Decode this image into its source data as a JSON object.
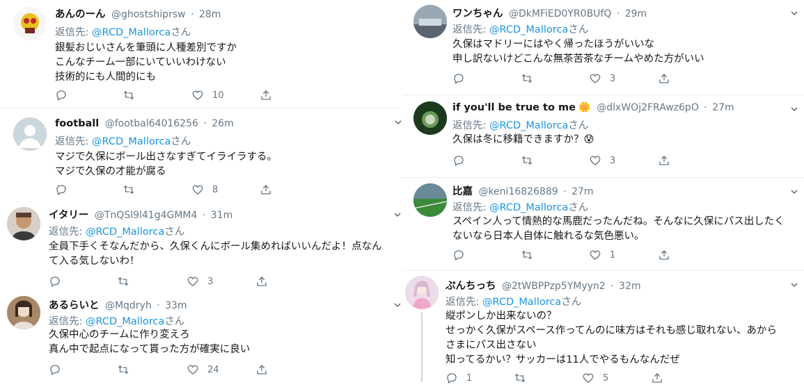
{
  "reply_prefix": "返信先: ",
  "reply_suffix": "さん",
  "icons": {
    "reply": "reply-icon",
    "retweet": "retweet-icon",
    "like": "heart-icon",
    "share": "share-icon",
    "more": "chevron-down-icon"
  },
  "colors": {
    "mention": "#1b95e0",
    "secondary": "#657786",
    "divider": "#e6ecf0"
  },
  "tweets": [
    {
      "name": "あんのーん",
      "handle": "@ghostshiprsw",
      "time": "28m",
      "reply_to": "@RCD_Mallorca",
      "lines": [
        "銀髪おじいさんを筆頭に人種差別ですか",
        "こんなチーム一部にいていいわけない",
        "技術的にも人間的にも"
      ],
      "replies": "",
      "retweets": "",
      "likes": "10"
    },
    {
      "name": "football",
      "handle": "@footbal64016256",
      "time": "26m",
      "reply_to": "@RCD_Mallorca",
      "lines": [
        "マジで久保にボール出さなすぎてイライラする。",
        "マジで久保の才能が腐る"
      ],
      "replies": "",
      "retweets": "",
      "likes": "8"
    },
    {
      "name": "イタリー",
      "handle": "@TnQSl9l41g4GMM4",
      "time": "31m",
      "reply_to": "@RCD_Mallorca",
      "lines": [
        "全員下手くそなんだから、久保くんにボール集めればいいんだよ！点なん",
        "て入る気しないわ！"
      ],
      "replies": "",
      "retweets": "",
      "likes": "3"
    },
    {
      "name": "あるらいと",
      "handle": "@Mqdryh",
      "time": "33m",
      "reply_to": "@RCD_Mallorca",
      "lines": [
        "久保中心のチームに作り変えろ",
        "真ん中で起点になって貰った方が確実に良い"
      ],
      "replies": "",
      "retweets": "",
      "likes": "24"
    },
    {
      "name": "ワンちゃん",
      "handle": "@DkMFiED0YR0BUfQ",
      "time": "29m",
      "reply_to": "@RCD_Mallorca",
      "lines": [
        "久保はマドリーにはやく帰ったほうがいいな",
        "申し訳ないけどこんな無茶苦茶なチームやめた方がいい"
      ],
      "replies": "",
      "retweets": "",
      "likes": "3"
    },
    {
      "name": "if you'll be true to me",
      "name_emoji": "🌼",
      "handle": "@dlxWOj2FRAwz6pO",
      "time": "27m",
      "reply_to": "@RCD_Mallorca",
      "lines": [
        "久保は冬に移籍できますか？😰"
      ],
      "replies": "",
      "retweets": "",
      "likes": "3"
    },
    {
      "name": "比嘉",
      "handle": "@keni16826889",
      "time": "27m",
      "reply_to": "@RCD_Mallorca",
      "lines": [
        "スペイン人って情熱的な馬鹿だったんだね。そんなに久保にパス出したく",
        "ないなら日本人自体に触れるな気色悪い。"
      ],
      "replies": "",
      "retweets": "",
      "likes": "1"
    },
    {
      "name": "ぷんちっち",
      "handle": "@2tWBPPzp5YMyyn2",
      "time": "32m",
      "reply_to": "@RCD_Mallorca",
      "lines": [
        "縦ポンしか出来ないの？",
        "せっかく久保がスペース作ってんのに味方はそれも感じ取れない、あから",
        "さまにパス出さない",
        "知ってるかい？サッカーは11人でやるもんなんだぜ"
      ],
      "replies": "1",
      "retweets": "",
      "likes": "5"
    }
  ]
}
